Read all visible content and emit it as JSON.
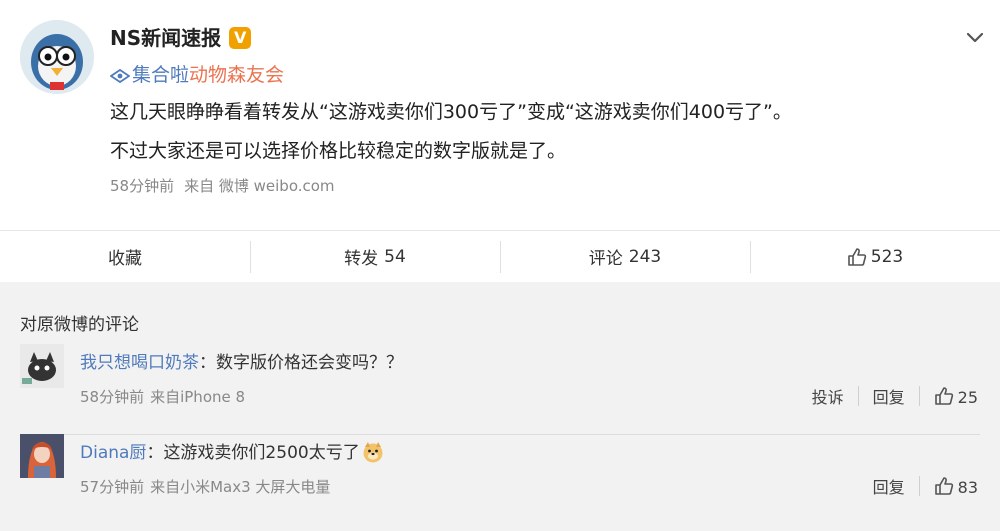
{
  "post": {
    "author": "NS新闻速报",
    "verified_badge": "V",
    "topic_prefix": "集合啦",
    "topic_name": "动物森友会",
    "text_line1": "这几天眼睁睁看着转发从“这游戏卖你们300亏了”变成“这游戏卖你们400亏了”。",
    "text_line2": "不过大家还是可以选择价格比较稳定的数字版就是了。",
    "time": "58分钟前",
    "source": "来自 微博 weibo.com",
    "icons": {
      "menu": "chevron-down-icon",
      "topic": "topic-eye-icon"
    }
  },
  "actions": {
    "favorite_label": "收藏",
    "repost_label": "转发",
    "repost_count": "54",
    "comment_label": "评论",
    "comment_count": "243",
    "like_count": "523"
  },
  "comments": {
    "title": "对原微博的评论",
    "items": [
      {
        "user": "我只想喝口奶茶",
        "separator": "：",
        "text_pre": "数字版价格还",
        "text_hl": "会",
        "text_post": "变吗？？",
        "time": "58分钟前",
        "source": "来自iPhone 8",
        "report_label": "投诉",
        "reply_label": "回复",
        "like_count": "25"
      },
      {
        "user": "Diana厨",
        "separator": "：",
        "text": "这游戏卖你们2500太亏了",
        "emoji": "doge-emoji",
        "time": "57分钟前",
        "source": "来自小米Max3 大屏大电量",
        "reply_label": "回复",
        "like_count": "83"
      }
    ]
  },
  "colors": {
    "link": "#4f7bbc",
    "highlight": "#eb7350",
    "badge": "#f0a100",
    "meta": "#888888"
  }
}
